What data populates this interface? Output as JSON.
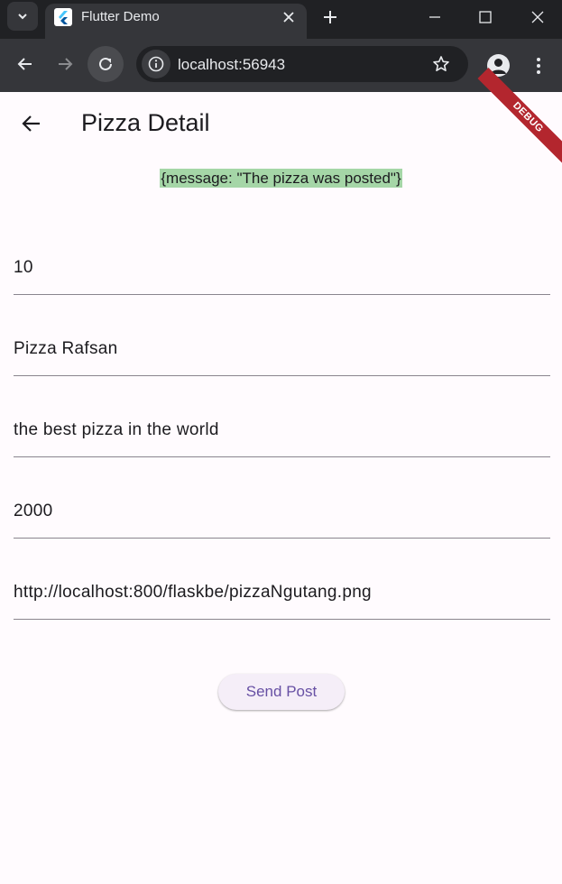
{
  "browser": {
    "tab_title": "Flutter Demo",
    "url": "localhost:56943"
  },
  "colors": {
    "tabstrip_bg": "#202124",
    "toolbar_bg": "#35363a",
    "app_bg": "#fffbfe",
    "message_highlight": "#a5d6a7",
    "button_text": "#6750a4",
    "debug_banner": "#b3262e"
  },
  "app": {
    "title": "Pizza Detail",
    "debug_label": "DEBUG",
    "message": "{message: \"The pizza was posted\"}",
    "fields": [
      {
        "value": "10"
      },
      {
        "value": "Pizza Rafsan"
      },
      {
        "value": "the best pizza in the world"
      },
      {
        "value": "2000"
      },
      {
        "value": "http://localhost:800/flaskbe/pizzaNgutang.png"
      }
    ],
    "send_label": "Send Post"
  }
}
